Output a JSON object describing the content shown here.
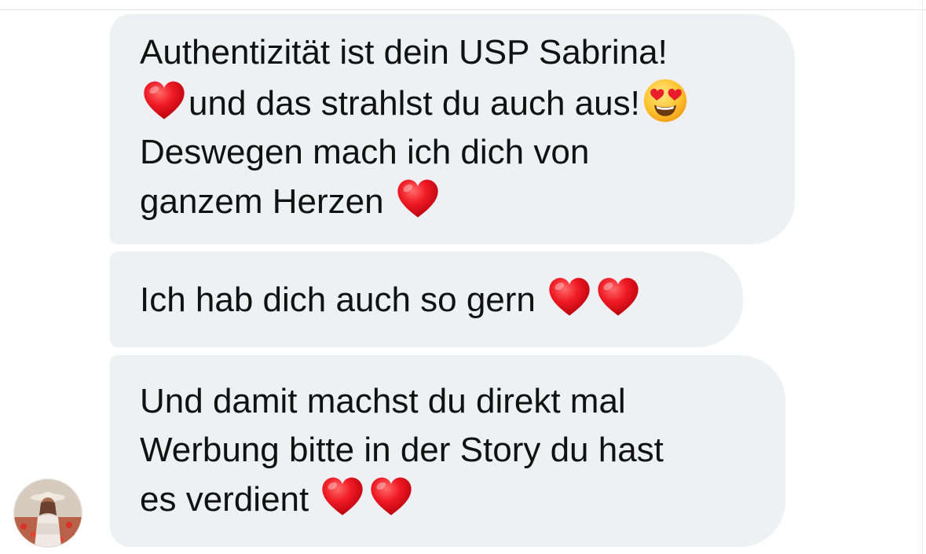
{
  "conversation": {
    "messages": [
      {
        "lines": [
          {
            "text": "Authentizität ist dein USP Sabrina!"
          },
          {
            "before": "",
            "text": "und das strahlst du auch aus!"
          },
          {
            "text": "Deswegen mach ich dich von"
          },
          {
            "text": "ganzem Herzen"
          }
        ]
      },
      {
        "lines": [
          {
            "text": "Ich hab dich auch so gern"
          }
        ]
      },
      {
        "lines": [
          {
            "text": "Und damit machst du direkt mal"
          },
          {
            "text": "Werbung bitte in der Story du hast"
          },
          {
            "text": "es verdient"
          }
        ]
      }
    ],
    "sender_avatar": "avatar-photo",
    "emoji": {
      "heart": "red-heart-emoji",
      "smiley": "heart-eyes-emoji"
    }
  },
  "colors": {
    "bubble_background": "#eff0f4",
    "text": "#111111",
    "heart": "#e8101e"
  }
}
